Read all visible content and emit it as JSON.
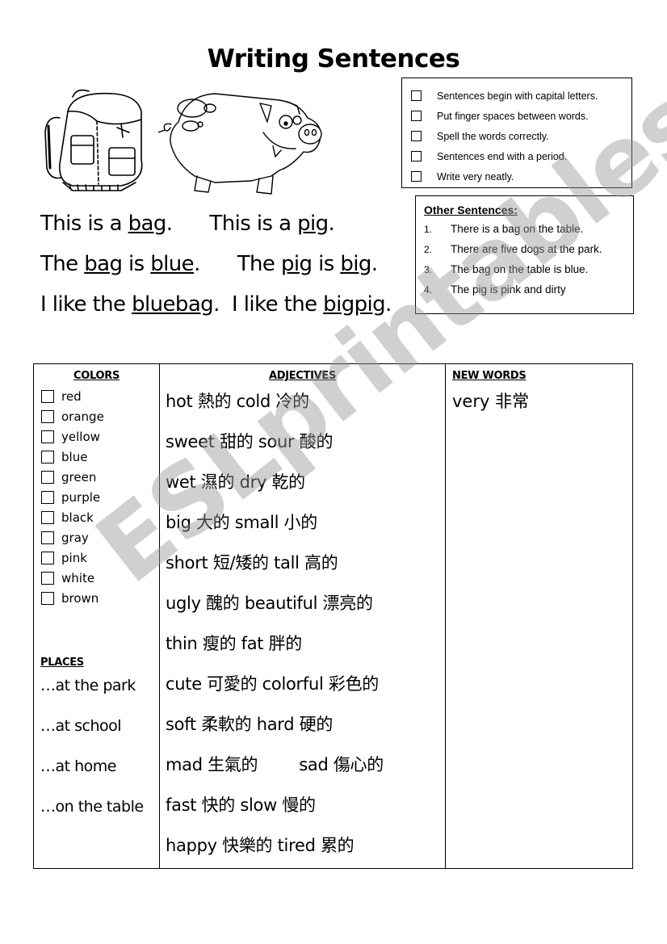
{
  "title": "Writing Sentences",
  "checklist": [
    "Sentences begin with capital letters.",
    "Put finger spaces between words.",
    "Spell the words correctly.",
    "Sentences end with a period.",
    "Write very neatly."
  ],
  "other_sentences": {
    "header": "Other Sentences:",
    "items": [
      {
        "num": "1.",
        "text": "There is a bag on the table."
      },
      {
        "num": "2.",
        "text": "There are five dogs at the park."
      },
      {
        "num": "3.",
        "text": "The bag on the table is blue."
      },
      {
        "num": "4.",
        "text": "The pig is pink and dirty"
      }
    ]
  },
  "sentences": {
    "line1": {
      "a": "This is a ",
      "b": "bag",
      "c": ".      This is a ",
      "d": "pig",
      "e": "."
    },
    "line2": {
      "a": "The ",
      "b": "bag",
      "c": " is ",
      "d": "blue",
      "e": ".      The ",
      "f": "pig",
      "g": " is ",
      "h": "big",
      "i": "."
    },
    "line3": {
      "a": "I like the ",
      "b": "bluebag",
      "c": ".  I like the ",
      "d": "bigpig",
      "e": "."
    }
  },
  "images": {
    "left": "backpack-drawing",
    "right": "pig-drawing"
  },
  "table": {
    "colors_header": "COLORS",
    "colors": [
      "red",
      "orange",
      "yellow",
      "blue",
      "green",
      "purple",
      "black",
      "gray",
      "pink",
      "white",
      "brown"
    ],
    "places_header": "PLACES",
    "places": [
      "…at the park",
      "…at school",
      "…at home",
      "…on the table"
    ],
    "adjectives_header": "ADJECTIVES",
    "adjectives": [
      "hot 熱的 cold 冷的",
      "sweet 甜的 sour 酸的",
      "wet 濕的 dry 乾的",
      "big 大的 small 小的",
      "short 短/矮的 tall 高的",
      "ugly 醜的 beautiful 漂亮的",
      "thin 瘦的 fat 胖的",
      "cute 可愛的 colorful 彩色的",
      "soft 柔軟的 hard 硬的",
      "mad 生氣的        sad 傷心的",
      "fast 快的 slow 慢的",
      "happy 快樂的 tired 累的"
    ],
    "new_words_header": "NEW WORDS",
    "new_words": [
      "very 非常"
    ]
  },
  "watermark": "ESLprintables.com"
}
